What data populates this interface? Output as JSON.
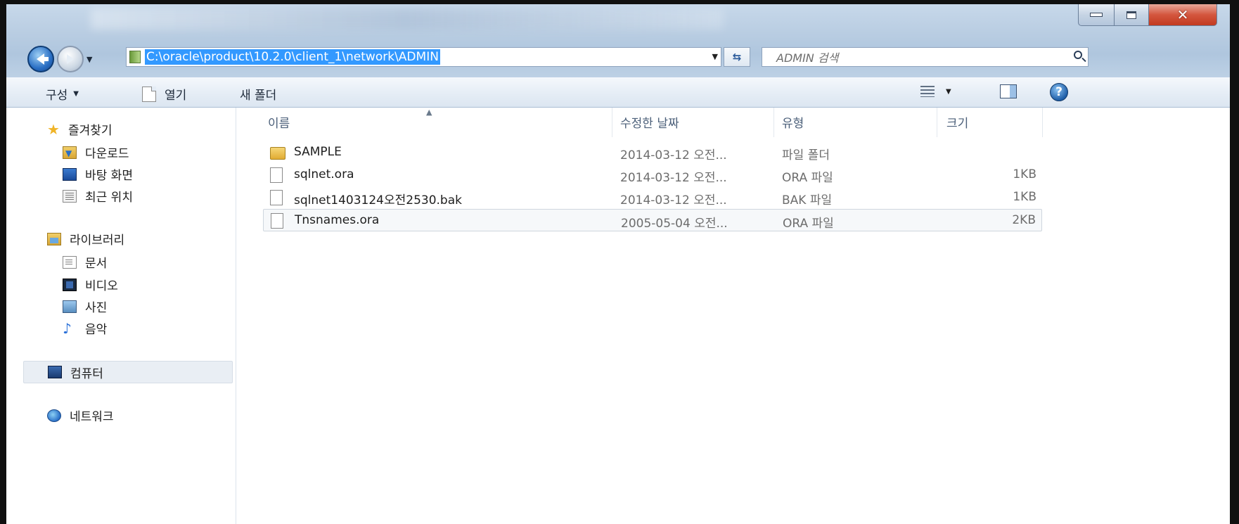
{
  "window": {
    "minimize_icon": "minimize-icon",
    "maximize_icon": "maximize-icon",
    "close_icon": "close-icon"
  },
  "address_bar": {
    "path": "C:\\oracle\\product\\10.2.0\\client_1\\network\\ADMIN"
  },
  "search": {
    "placeholder": "ADMIN 검색"
  },
  "toolbar": {
    "organize_label": "구성",
    "open_label": "열기",
    "new_folder_label": "새 폴더"
  },
  "sidebar": {
    "favorites": {
      "label": "즐겨찾기",
      "items": [
        {
          "label": "다운로드",
          "icon": "download-folder-icon"
        },
        {
          "label": "바탕 화면",
          "icon": "desktop-icon"
        },
        {
          "label": "최근 위치",
          "icon": "recent-places-icon"
        }
      ]
    },
    "libraries": {
      "label": "라이브러리",
      "items": [
        {
          "label": "문서",
          "icon": "documents-icon"
        },
        {
          "label": "비디오",
          "icon": "video-icon"
        },
        {
          "label": "사진",
          "icon": "pictures-icon"
        },
        {
          "label": "음악",
          "icon": "music-icon"
        }
      ]
    },
    "computer": {
      "label": "컴퓨터"
    },
    "network": {
      "label": "네트워크"
    }
  },
  "columns": {
    "name": "이름",
    "date": "수정한 날짜",
    "type": "유형",
    "size": "크기"
  },
  "files": [
    {
      "name": "SAMPLE",
      "date": "2014-03-12 오전...",
      "type": "파일 폴더",
      "size": "",
      "icon": "folder-icon"
    },
    {
      "name": "sqlnet.ora",
      "date": "2014-03-12 오전...",
      "type": "ORA 파일",
      "size": "1KB",
      "icon": "file-icon"
    },
    {
      "name": "sqlnet1403124오전2530.bak",
      "date": "2014-03-12 오전...",
      "type": "BAK 파일",
      "size": "1KB",
      "icon": "file-icon"
    },
    {
      "name": "Tnsnames.ora",
      "date": "2005-05-04 오전...",
      "type": "ORA 파일",
      "size": "2KB",
      "icon": "file-icon"
    }
  ],
  "colors": {
    "address_selection": "#3399ff",
    "chrome": "#b9cde2",
    "toolbar": "#e4ecf5"
  }
}
